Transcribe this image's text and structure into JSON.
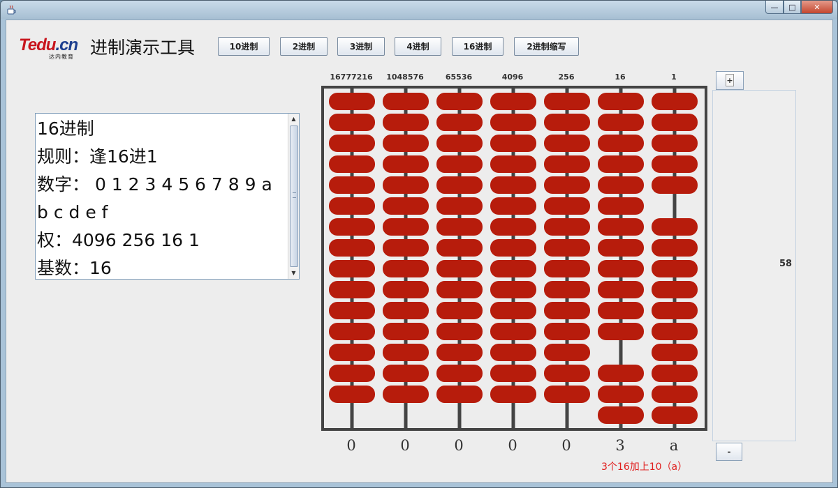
{
  "window": {
    "icon": "java-cup-icon",
    "buttons": {
      "minimize": "—",
      "maximize": "□",
      "close": "✕"
    }
  },
  "logo": {
    "main_left": "Tedu",
    "main_right": ".cn",
    "sub": "达内教育"
  },
  "app_title": "进制演示工具",
  "toolbar": {
    "buttons": [
      "10进制",
      "2进制",
      "3进制",
      "4进制",
      "16进制",
      "2进制缩写"
    ]
  },
  "info": {
    "lines": [
      "16进制",
      "规则：逢16进1",
      "数字： 0 1 2 3 4 5 6 7 8 9 a",
      "b c d e f",
      "权：4096 256 16 1",
      "基数：16"
    ]
  },
  "abacus": {
    "weights": [
      "16777216",
      "1048576",
      "65536",
      "4096",
      "256",
      "16",
      "1"
    ],
    "digits": [
      "0",
      "0",
      "0",
      "0",
      "0",
      "3",
      "a"
    ],
    "digit_values": [
      0,
      0,
      0,
      0,
      0,
      3,
      10
    ],
    "beads_per_rod": 15,
    "bead_color": "#b71c0c",
    "frame_color": "#444444",
    "explanation": "3个16加上10（a）"
  },
  "side": {
    "plus_label": "+",
    "minus_label": "-",
    "value": "58"
  }
}
